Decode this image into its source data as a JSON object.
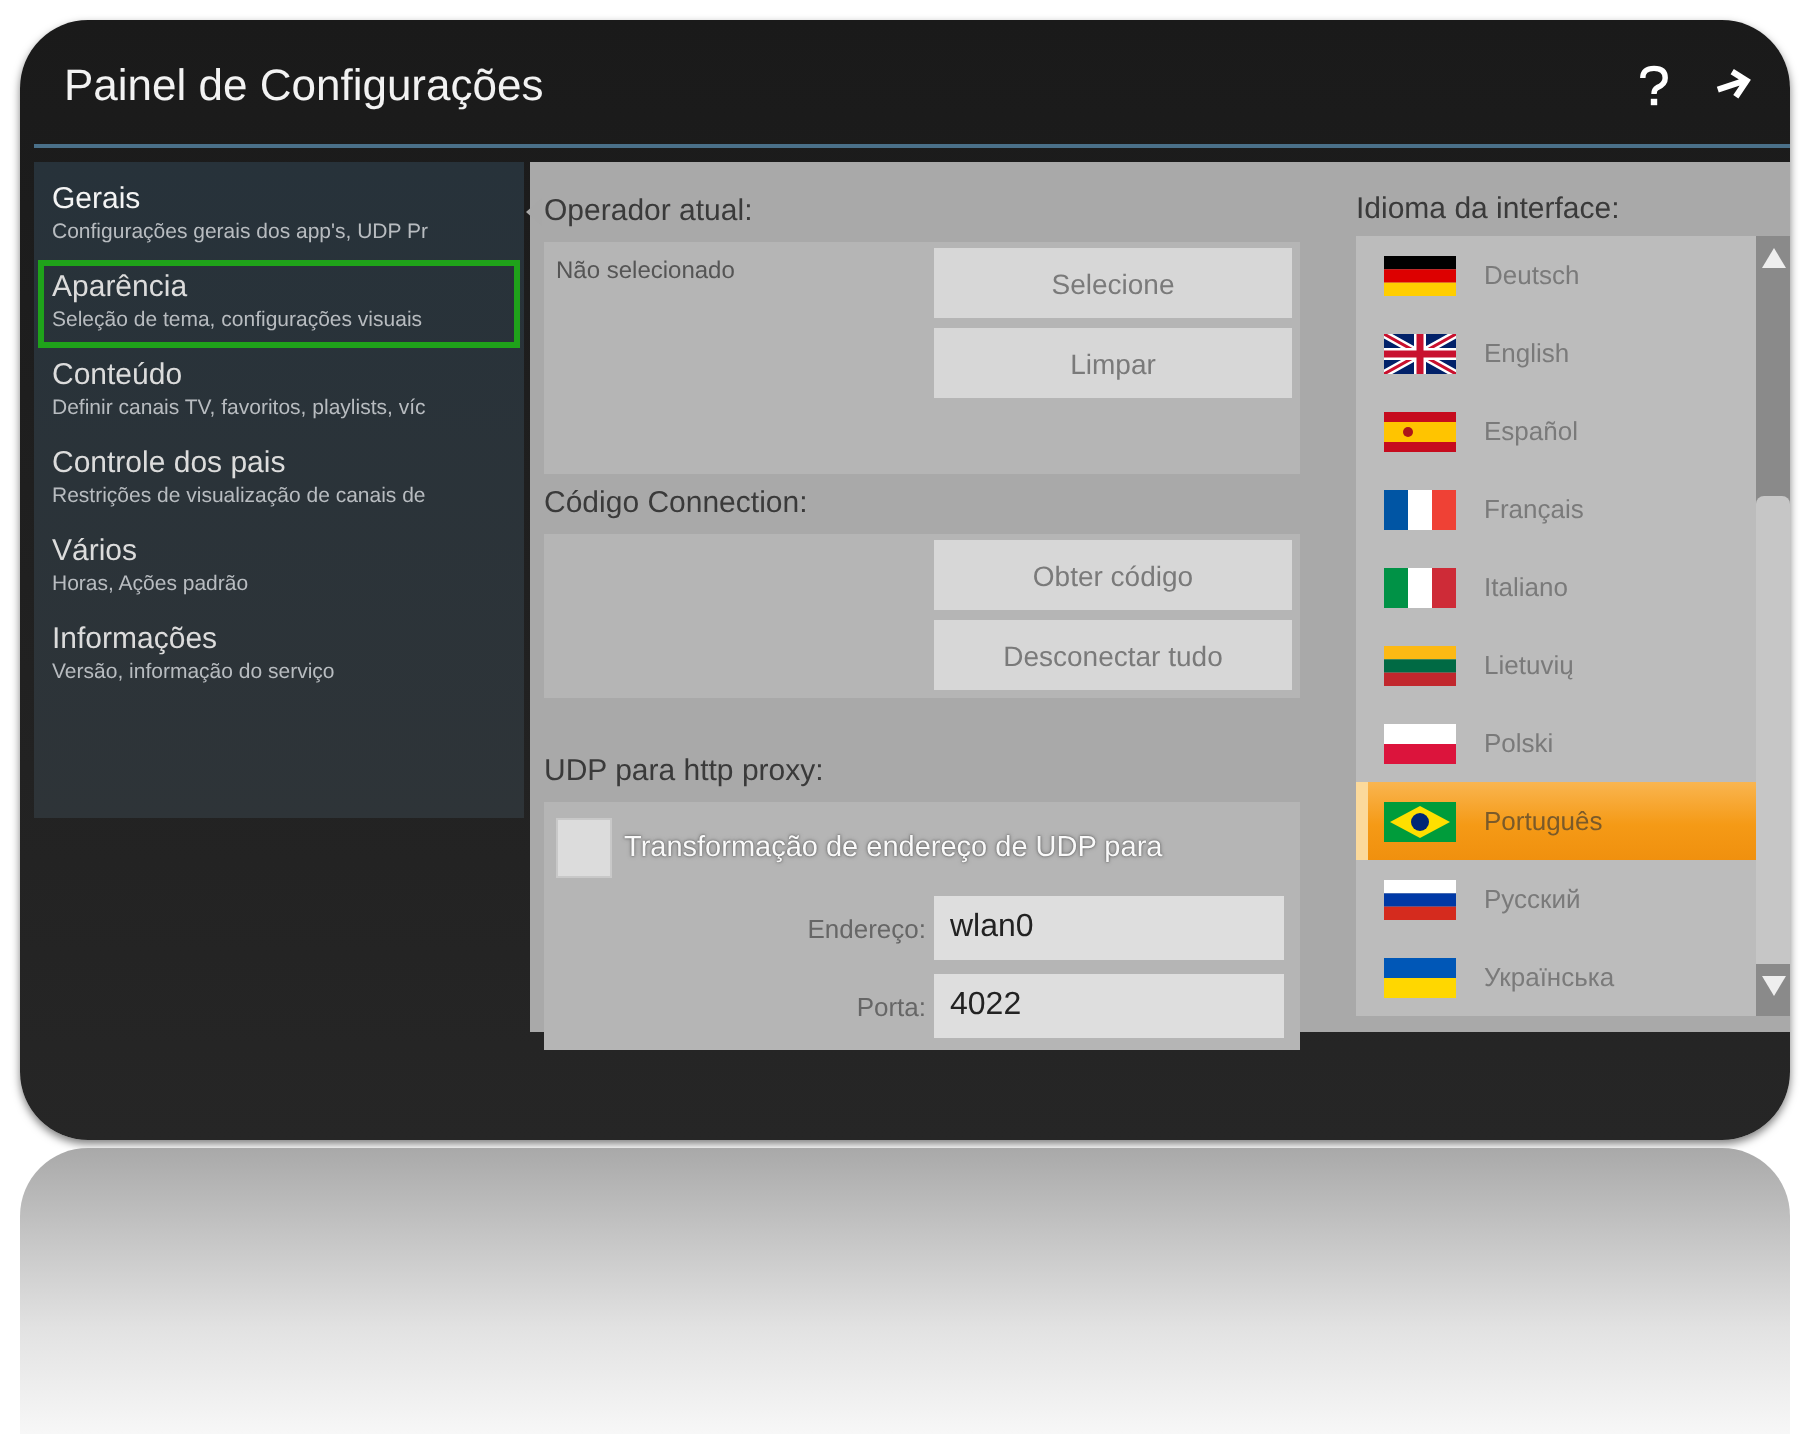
{
  "window": {
    "title": "Painel de Configurações"
  },
  "sidebar": {
    "items": [
      {
        "title": "Gerais",
        "subtitle": "Configurações gerais dos app's, UDP Pr",
        "selected": true,
        "highlighted": false
      },
      {
        "title": "Aparência",
        "subtitle": "Seleção de tema, configurações visuais",
        "selected": false,
        "highlighted": true
      },
      {
        "title": "Conteúdo",
        "subtitle": "Definir canais TV, favoritos, playlists, víc",
        "selected": false,
        "highlighted": false
      },
      {
        "title": "Controle dos pais",
        "subtitle": "Restrições de visualização de canais de",
        "selected": false,
        "highlighted": false
      },
      {
        "title": "Vários",
        "subtitle": "Horas, Ações padrão",
        "selected": false,
        "highlighted": false
      },
      {
        "title": "Informações",
        "subtitle": "Versão, informação do serviço",
        "selected": false,
        "highlighted": false
      }
    ]
  },
  "operator": {
    "label": "Operador atual:",
    "value": "Não selecionado",
    "buttons": [
      "Selecione",
      "Limpar"
    ]
  },
  "connection": {
    "label": "Código Connection:",
    "buttons": [
      "Obter código",
      "Desconectar tudo"
    ]
  },
  "udp_proxy": {
    "label": "UDP para http proxy:",
    "checkbox": {
      "label": "Transformação de endereço de UDP para",
      "checked": false
    },
    "fields": [
      {
        "label": "Endereço:",
        "value": "wlan0"
      },
      {
        "label": "Porta:",
        "value": "4022"
      }
    ]
  },
  "language": {
    "label": "Idioma da interface:",
    "items": [
      {
        "name": "Deutsch",
        "kind": "de",
        "selected": false
      },
      {
        "name": "English",
        "kind": "gb",
        "selected": false
      },
      {
        "name": "Español",
        "kind": "es",
        "selected": false
      },
      {
        "name": "Français",
        "kind": "fr",
        "selected": false
      },
      {
        "name": "Italiano",
        "kind": "it",
        "selected": false
      },
      {
        "name": "Lietuvių",
        "kind": "lt",
        "selected": false
      },
      {
        "name": "Polski",
        "kind": "pl",
        "selected": false
      },
      {
        "name": "Português",
        "kind": "br",
        "selected": true
      },
      {
        "name": "Русский",
        "kind": "ru",
        "selected": false
      },
      {
        "name": "Українська",
        "kind": "ua",
        "selected": false
      }
    ]
  }
}
